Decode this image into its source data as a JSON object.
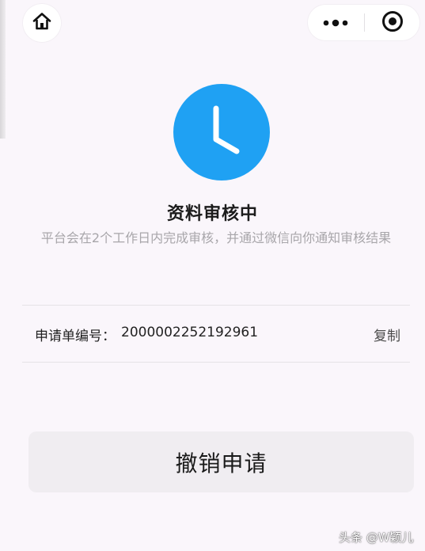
{
  "header": {
    "home_icon": "home-icon",
    "more_icon": "more-dots-icon",
    "target_icon": "target-circle-icon"
  },
  "status": {
    "icon": "clock-icon",
    "icon_color": "#1fa1f3",
    "title": "资料审核中",
    "description": "平台会在2个工作日内完成审核，并通过微信向你通知审核结果"
  },
  "order": {
    "label": "申请单编号：",
    "number": "2000002252192961",
    "copy_label": "复制"
  },
  "actions": {
    "cancel_label": "撤销申请"
  },
  "watermark": "头条 @W颖儿"
}
